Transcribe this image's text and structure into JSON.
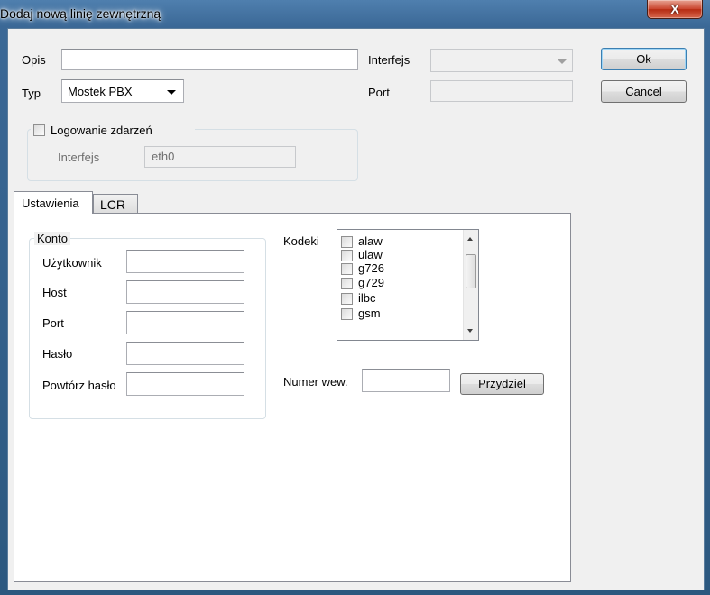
{
  "window": {
    "title": "Dodaj nową linię zewnętrzną",
    "close_glyph": "X"
  },
  "form": {
    "opis_label": "Opis",
    "opis_value": "",
    "typ_label": "Typ",
    "typ_value": "Mostek PBX",
    "interfejs_label": "Interfejs",
    "interfejs_value": "",
    "port_label": "Port",
    "port_value": ""
  },
  "buttons": {
    "ok": "Ok",
    "cancel": "Cancel",
    "assign": "Przydziel"
  },
  "logging": {
    "label": "Logowanie zdarzeń",
    "checked": false,
    "interface_label": "Interfejs",
    "interface_value": "eth0"
  },
  "tabs": [
    {
      "label": "Ustawienia",
      "active": true
    },
    {
      "label": "LCR",
      "active": false
    }
  ],
  "account": {
    "group_title": "Konto",
    "fields": [
      {
        "label": "Użytkownik",
        "value": ""
      },
      {
        "label": "Host",
        "value": ""
      },
      {
        "label": "Port",
        "value": ""
      },
      {
        "label": "Hasło",
        "value": ""
      },
      {
        "label": "Powtórz hasło",
        "value": ""
      }
    ]
  },
  "codecs": {
    "label": "Kodeki",
    "items": [
      {
        "name": "alaw",
        "checked": false
      },
      {
        "name": "ulaw",
        "checked": false
      },
      {
        "name": "g726",
        "checked": false
      },
      {
        "name": "g729",
        "checked": false
      },
      {
        "name": "ilbc",
        "checked": false
      },
      {
        "name": "gsm",
        "checked": false
      }
    ]
  },
  "extension": {
    "label": "Numer wew.",
    "value": ""
  }
}
